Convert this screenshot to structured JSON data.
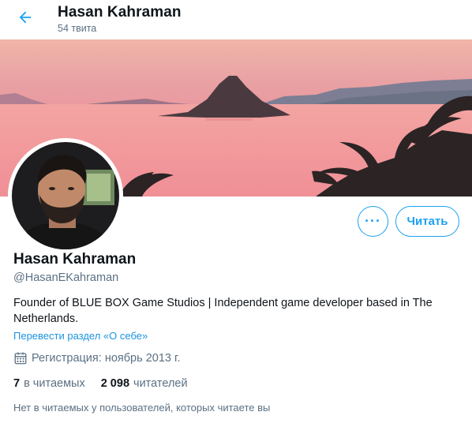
{
  "header": {
    "name": "Hasan Kahraman",
    "tweet_count": "54 твита"
  },
  "actions": {
    "more_label": "···",
    "follow_label": "Читать"
  },
  "profile": {
    "name": "Hasan Kahraman",
    "handle": "@HasanEKahraman",
    "bio_line1": "Founder of BLUE BOX Game Studios | Independent game developer based in The",
    "bio_line2": "Netherlands.",
    "translate_link": "Перевести раздел «О себе»",
    "joined": "Регистрация: ноябрь 2013 г."
  },
  "stats": {
    "following_count": "7",
    "following_label": "в читаемых",
    "followers_count": "2 098",
    "followers_label": "читателей"
  },
  "followed_by_text": "Нет в читаемых у пользователей, которых читаете вы",
  "colors": {
    "accent": "#1da1f2",
    "text_primary": "#0f1419",
    "text_secondary": "#5b7083",
    "banner_sky": "#e9a8a8",
    "banner_sea": "#f29d9d"
  },
  "icons": {
    "back": "arrow-left-icon",
    "calendar": "calendar-icon"
  }
}
